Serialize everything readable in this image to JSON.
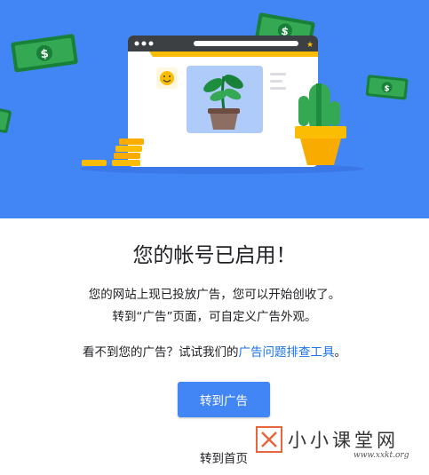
{
  "hero": {
    "illustration": "adsense-activated-plant-browser-illustration",
    "background_color": "#4285f4",
    "icons": [
      "money-bill-icon",
      "coin-stack-icon",
      "cactus-icon",
      "potted-plant-icon",
      "smiley-avatar-icon",
      "star-icon"
    ]
  },
  "main": {
    "title": "您的帐号已启用！",
    "line1": "您的网站上现已投放广告，您可以开始创收了。",
    "line2": "转到“广告”页面，可自定义广告外观。",
    "help_prefix": "看不到您的广告？试试我们的",
    "help_link": "广告问题排查工具",
    "help_suffix": "。",
    "primary_button": "转到广告",
    "secondary_link": "转到首页"
  },
  "watermark": {
    "text": "小小课堂网",
    "url": "www.xxkt.org",
    "accent_color": "#e8663d"
  }
}
